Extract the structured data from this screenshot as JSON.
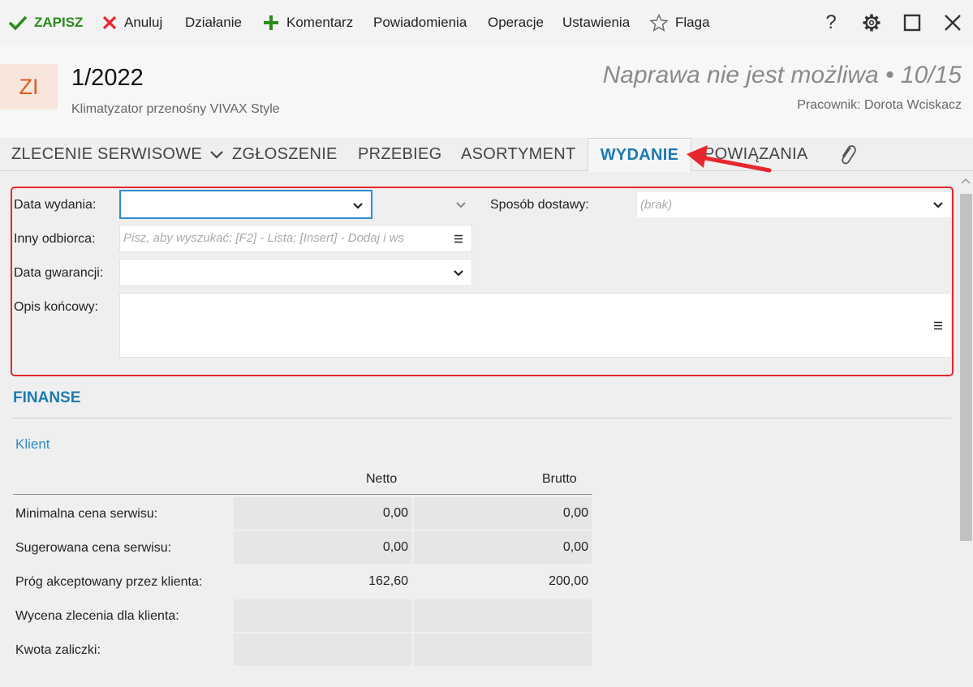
{
  "toolbar": {
    "save": "ZAPISZ",
    "cancel": "Anuluj",
    "action": "Działanie",
    "comment": "Komentarz",
    "notifications": "Powiadomienia",
    "operations": "Operacje",
    "settings": "Ustawienia",
    "flag": "Flaga",
    "help": "?"
  },
  "header": {
    "badge": "ZI",
    "number": "1/2022",
    "subtitle": "Klimatyzator przenośny VIVAX Style",
    "status": "Naprawa nie jest możliwa • 10/15",
    "worker": "Pracownik: Dorota Wciskacz"
  },
  "tabs": [
    {
      "label": "ZLECENIE SERWISOWE"
    },
    {
      "label": "ZGŁOSZENIE"
    },
    {
      "label": "PRZEBIEG"
    },
    {
      "label": "ASORTYMENT"
    },
    {
      "label": "WYDANIE"
    },
    {
      "label": "POWIĄZANIA"
    }
  ],
  "form": {
    "release_date_label": "Data wydania:",
    "delivery_label": "Sposób dostawy:",
    "delivery_value": "(brak)",
    "recipient_label": "Inny odbiorca:",
    "recipient_placeholder": "Pisz, aby wyszukać; [F2] - Lista; [Insert] - Dodaj i ws",
    "warranty_label": "Data gwarancji:",
    "final_desc_label": "Opis końcowy:"
  },
  "finanse": {
    "title": "FINANSE",
    "section": "Klient",
    "columns": [
      "Netto",
      "Brutto"
    ],
    "rows": [
      {
        "label": "Minimalna cena serwisu:",
        "netto": "0,00",
        "brutto": "0,00"
      },
      {
        "label": "Sugerowana cena serwisu:",
        "netto": "0,00",
        "brutto": "0,00"
      },
      {
        "label": "Próg akceptowany przez klienta:",
        "netto": "162,60",
        "brutto": "200,00"
      },
      {
        "label": "Wycena zlecenia dla klienta:",
        "netto": "",
        "brutto": ""
      },
      {
        "label": "Kwota zaliczki:",
        "netto": "",
        "brutto": ""
      }
    ]
  },
  "colors": {
    "accent": "#1b7bb0",
    "save_green": "#2b8a1c",
    "cancel_red": "#e8262d",
    "highlight_red": "#e8262d",
    "badge_bg": "#f8e6dc",
    "badge_text": "#e15b1f"
  },
  "icons": {
    "save": "check-icon",
    "cancel": "x-icon",
    "comment": "plus-icon",
    "flag": "star-icon",
    "settings": "gear-icon",
    "maximize": "square-icon",
    "close": "close-icon",
    "attachment": "paperclip-icon"
  }
}
